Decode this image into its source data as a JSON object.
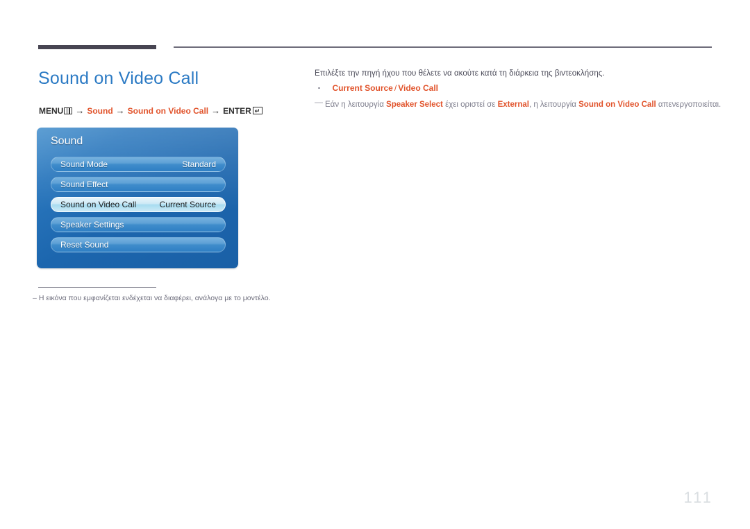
{
  "page": {
    "title": "Sound on Video Call",
    "number": "111"
  },
  "menu_path": {
    "menu_label": "MENU",
    "menu_icon": "menu-bars-icon",
    "arrow": "→",
    "step1": "Sound",
    "step2": "Sound on Video Call",
    "enter_label": "ENTER",
    "enter_icon": "enter-return-icon"
  },
  "osd": {
    "title": "Sound",
    "rows": [
      {
        "label": "Sound Mode",
        "value": "Standard",
        "selected": false
      },
      {
        "label": "Sound Effect",
        "value": "",
        "selected": false
      },
      {
        "label": "Sound on Video Call",
        "value": "Current Source",
        "selected": true
      },
      {
        "label": "Speaker Settings",
        "value": "",
        "selected": false
      },
      {
        "label": "Reset Sound",
        "value": "",
        "selected": false
      }
    ]
  },
  "left_footnote": {
    "dash": "–",
    "text": "Η εικόνα που εμφανίζεται ενδέχεται να διαφέρει, ανάλογα με το μοντέλο."
  },
  "right_column": {
    "lead": "Επιλέξτε την πηγή ήχου που θέλετε να ακούτε κατά τη διάρκεια της βιντεοκλήσης.",
    "bullet": {
      "option1": "Current Source",
      "separator": "/",
      "option2": "Video Call"
    },
    "note": {
      "dash": "—",
      "part1": "Εάν η λειτουργία ",
      "em1": "Speaker Select",
      "part2": " έχει οριστεί σε ",
      "em2": "External",
      "part3": ", η λειτουργία ",
      "em3": "Sound on Video Call",
      "part4": " απενεργοποιείται."
    }
  },
  "colors": {
    "title_blue": "#2b7ac4",
    "accent_orange": "#e1532b",
    "rule_dark": "#474552",
    "body_gray": "#7d7d8c",
    "page_number_gray": "#d9dee1"
  }
}
